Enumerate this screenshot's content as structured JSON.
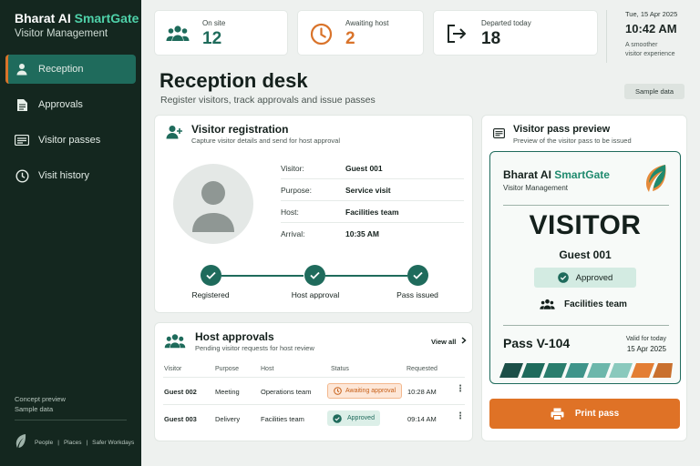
{
  "brand": {
    "name_part1": "Bharat AI",
    "name_part2": "SmartGate",
    "subtitle": "Visitor Management"
  },
  "sidebar": {
    "items": [
      {
        "label": "Reception",
        "icon": "person-icon",
        "active": true
      },
      {
        "label": "Approvals",
        "icon": "document-icon",
        "active": false
      },
      {
        "label": "Visitor passes",
        "icon": "id-card-icon",
        "active": false
      },
      {
        "label": "Visit history",
        "icon": "clock-icon",
        "active": false
      }
    ],
    "footer_line1": "Concept preview",
    "footer_line2": "Sample data",
    "bottom_tags": [
      "People",
      "Places",
      "Safer Workdays"
    ]
  },
  "stats": {
    "on_site": {
      "label": "On site",
      "value": "12",
      "icon": "group-icon",
      "color": "#1e6b5b"
    },
    "awaiting": {
      "label": "Awaiting host",
      "value": "2",
      "icon": "clock-icon",
      "color": "#d9732a"
    },
    "departed": {
      "label": "Departed today",
      "value": "18",
      "icon": "exit-icon",
      "color": "#1c2623"
    }
  },
  "datetime": {
    "date": "Tue, 15 Apr 2025",
    "time": "10:42 AM",
    "tagline_1": "A smoother",
    "tagline_2": "visitor experience"
  },
  "page": {
    "title": "Reception desk",
    "subtitle": "Register visitors, track approvals and issue passes",
    "sample_button": "Sample data"
  },
  "registration": {
    "title": "Visitor registration",
    "subtitle": "Capture visitor details and send for host approval",
    "fields": [
      {
        "label": "Visitor:",
        "value": "Guest 001"
      },
      {
        "label": "Purpose:",
        "value": "Service visit"
      },
      {
        "label": "Host:",
        "value": "Facilities team"
      },
      {
        "label": "Arrival:",
        "value": "10:35 AM"
      }
    ],
    "steps": [
      "Registered",
      "Host approval",
      "Pass issued"
    ]
  },
  "approvals": {
    "title": "Host approvals",
    "subtitle": "Pending visitor requests for host review",
    "view_all": "View all",
    "columns": [
      "Visitor",
      "Purpose",
      "Host",
      "Status",
      "Requested"
    ],
    "rows": [
      {
        "visitor": "Guest 002",
        "purpose": "Meeting",
        "host": "Operations team",
        "status": "Awaiting approval",
        "requested": "10:28 AM"
      },
      {
        "visitor": "Guest 003",
        "purpose": "Delivery",
        "host": "Facilities team",
        "status": "Approved",
        "requested": "09:14 AM"
      }
    ]
  },
  "pass": {
    "title": "Visitor pass preview",
    "subtitle": "Preview of the visitor pass to be issued",
    "brand_part1": "Bharat AI",
    "brand_part2": "SmartGate",
    "brand_sub": "Visitor Management",
    "type": "VISITOR",
    "guest": "Guest 001",
    "status": "Approved",
    "team": "Facilities team",
    "pass_no": "Pass V-104",
    "valid_label": "Valid for today",
    "valid_date": "15 Apr 2025",
    "print_label": "Print pass"
  },
  "colors": {
    "sidebar_bg": "#14271f",
    "accent_teal": "#1f6b5c",
    "accent_orange": "#df7226"
  }
}
